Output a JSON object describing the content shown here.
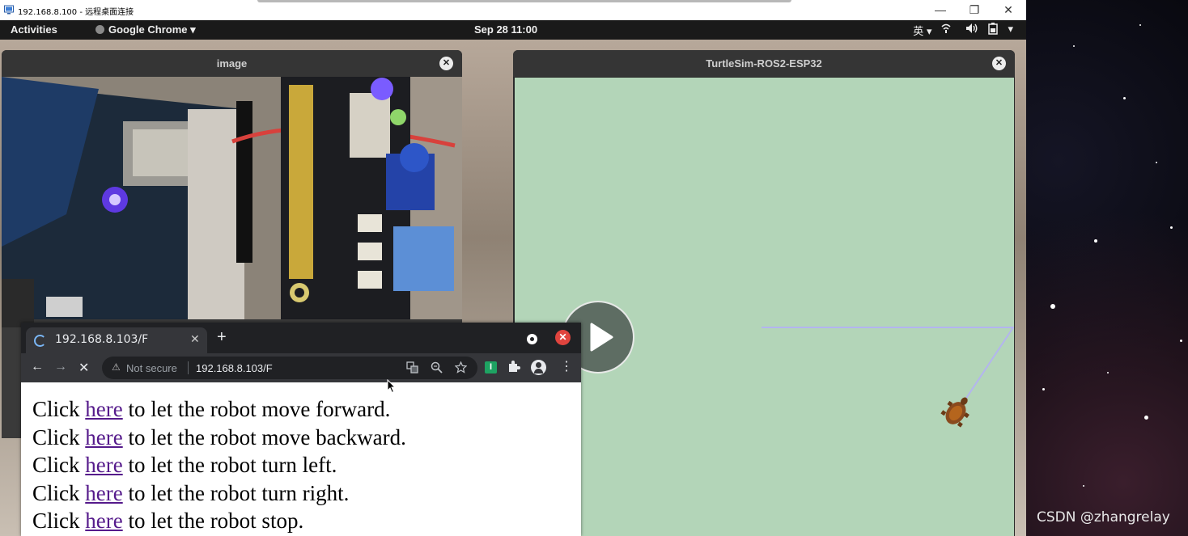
{
  "rdp_window": {
    "title": "192.168.8.100 - 远程桌面连接",
    "minimize_label": "—",
    "restore_label": "❐",
    "close_label": "✕"
  },
  "gnome_bar": {
    "activities": "Activities",
    "app_menu": "Google Chrome",
    "app_menu_arrow": "▾",
    "clock": "Sep 28  11:00",
    "input_method": "英",
    "input_method_arrow": "▾",
    "network_icon": "network-icon",
    "volume_icon": "volume-icon",
    "battery_icon": "battery-icon",
    "system_menu_arrow": "▾"
  },
  "image_window": {
    "title": "image",
    "close_label": "✕"
  },
  "turtle_window": {
    "title": "TurtleSim-ROS2-ESP32",
    "close_label": "✕",
    "background_color": "#b3d5b8",
    "pen_color": "#b3b4f0"
  },
  "chrome": {
    "tab_title": "192.168.8.103/F",
    "tab_close": "✕",
    "new_tab": "+",
    "window_close": "✕",
    "back": "←",
    "forward": "→",
    "stop": "✕",
    "warning_icon": "⚠",
    "not_secure": "Not secure",
    "url": "192.168.8.103/F",
    "ext_green_label": "I",
    "menu": "⋮",
    "page_lines": [
      {
        "before": "Click ",
        "link": "here",
        "after": " to let the robot move forward."
      },
      {
        "before": "Click ",
        "link": "here",
        "after": " to let the robot move backward."
      },
      {
        "before": "Click ",
        "link": "here",
        "after": " to let the robot turn left."
      },
      {
        "before": "Click ",
        "link": "here",
        "after": " to let the robot turn right."
      },
      {
        "before": "Click ",
        "link": "here",
        "after": " to let the robot stop."
      }
    ]
  },
  "watermark": "CSDN @zhangrelay"
}
